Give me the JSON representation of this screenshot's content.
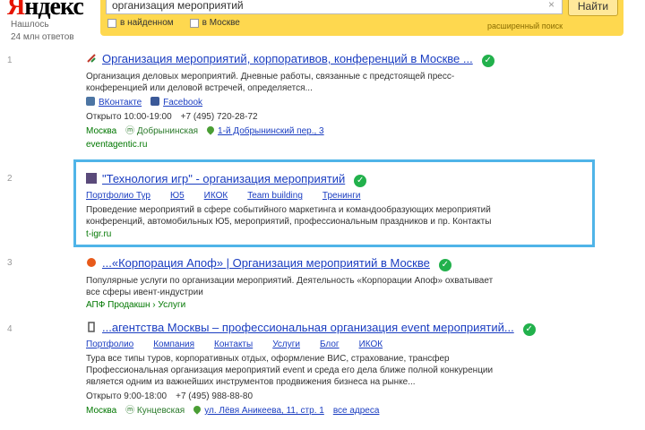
{
  "header": {
    "logo_ya": "Я",
    "logo_rest": "ндекс",
    "logo_sub1": "Нашлось",
    "logo_sub2": "24 млн ответов",
    "search_value": "организация мероприятий",
    "search_button": "Найти",
    "check1": "в найденном",
    "check2": "в Москве",
    "advanced": "расширенный поиск"
  },
  "results": [
    {
      "num": "1",
      "title": "Организация мероприятий, корпоративов, конференций в Москве ...",
      "snippet1": "Организация деловых мероприятий. Дневные работы, связанные с предстоящей пресс-",
      "snippet2": "конференцией или деловой встречей, определяется...",
      "social1": "ВКонтакте",
      "social2": "Facebook",
      "hours": "Открыто 10:00-19:00",
      "phone": "+7 (495) 720-28-72",
      "city": "Москва",
      "metro": "Добрынинская",
      "address": "1-й Добрынинский пер., 3",
      "url": "eventagentic.ru"
    },
    {
      "num": "2",
      "title": "\"Технология игр\" - организация мероприятий",
      "sitelinks": [
        "Портфолио Тур",
        "Ю5",
        "ИКОК",
        "Team building",
        "Тренинги"
      ],
      "snippet1": "Проведение мероприятий в сфере событийного маркетинга и командообразующих мероприятий",
      "snippet2": "конференций, автомобильных Ю5, мероприятий, профессиональным праздников и пр. Контакты",
      "url": "t-igr.ru"
    },
    {
      "num": "3",
      "title": "...«Корпорация Апоф» | Организация мероприятий в Москве",
      "snippet1": "Популярные услуги по организации мероприятий. Деятельность «Корпорации Апоф» охватывает",
      "snippet2": "все сферы ивент-индустрии",
      "url": "АПФ Продакшн › Услуги"
    },
    {
      "num": "4",
      "title": "...агентства Москвы – профессиональная организация event мероприятий...",
      "sitelinks": [
        "Портфолио",
        "Компания",
        "Контакты",
        "Услуги",
        "Блог",
        "ИКОК"
      ],
      "snippet1": "Тура все типы туров, корпоративных отдых, оформление ВИС, страхование, трансфер",
      "snippet2": "Профессиональная организация мероприятий event и среда его дела ближе полной конкуренции",
      "snippet3": "является одним из важнейших инструментов продвижения бизнеса на рынке...",
      "hours": "Открыто 9:00-18:00",
      "phone": "+7 (495) 988-88-80",
      "city": "Москва",
      "metro": "Кунцевская",
      "address": "ул. Лёвя Аникеева, 11, стр. 1",
      "extra": "все адреса"
    }
  ],
  "colors": {
    "accent_yellow": "#fed84f",
    "link": "#1a3dc1",
    "highlight": "#4fb4e8",
    "verified": "#22b14c"
  }
}
